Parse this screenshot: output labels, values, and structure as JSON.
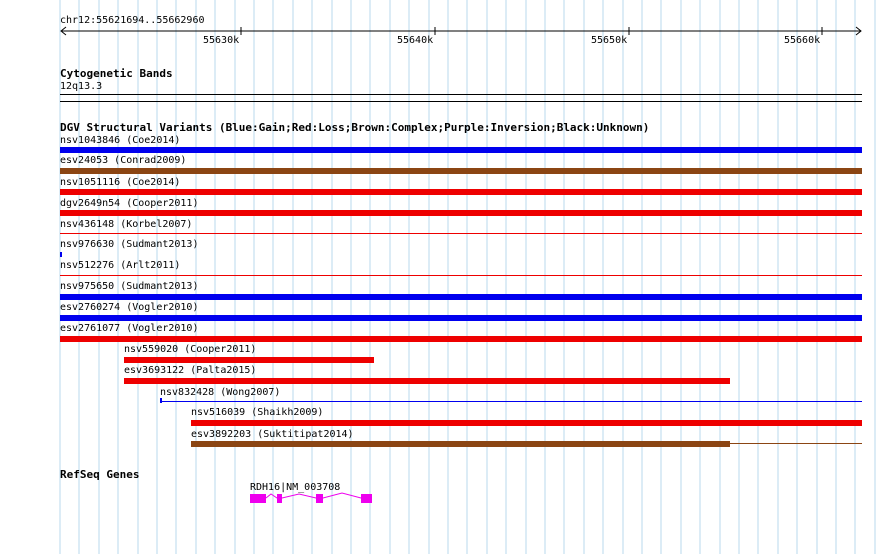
{
  "ruler": {
    "region": "chr12:55621694..55662960",
    "ticks": [
      "55630k",
      "55640k",
      "55650k",
      "55660k"
    ]
  },
  "cytoband": {
    "title": "Cytogenetic Bands",
    "band": "12q13.3"
  },
  "dgv": {
    "title": "DGV Structural Variants (Blue:Gain;Red:Loss;Brown:Complex;Purple:Inversion;Black:Unknown)",
    "colors": {
      "gain": "#0000ee",
      "loss": "#ee0000",
      "complex": "#8b4513"
    },
    "variants": [
      {
        "label": "nsv1043846 (Coe2014)",
        "type": "gain"
      },
      {
        "label": "esv24053 (Conrad2009)",
        "type": "complex"
      },
      {
        "label": "nsv1051116 (Coe2014)",
        "type": "loss"
      },
      {
        "label": "dgv2649n54 (Cooper2011)",
        "type": "loss"
      },
      {
        "label": "nsv436148 (Korbel2007)",
        "type": "loss"
      },
      {
        "label": "nsv976630 (Sudmant2013)",
        "type": "gain"
      },
      {
        "label": "nsv512276 (Arlt2011)",
        "type": "loss"
      },
      {
        "label": "nsv975650 (Sudmant2013)",
        "type": "gain"
      },
      {
        "label": "esv2760274 (Vogler2010)",
        "type": "gain"
      },
      {
        "label": "esv2761077 (Vogler2010)",
        "type": "loss"
      },
      {
        "label": "nsv559020 (Cooper2011)",
        "type": "loss"
      },
      {
        "label": "esv3693122 (Palta2015)",
        "type": "loss"
      },
      {
        "label": "nsv832428 (Wong2007)",
        "type": "gain"
      },
      {
        "label": "nsv516039 (Shaikh2009)",
        "type": "loss"
      },
      {
        "label": "esv3892203 (Suktitipat2014)",
        "type": "complex"
      }
    ]
  },
  "refseq": {
    "title": "RefSeq Genes",
    "gene_label": "RDH16|NM_003708",
    "color": "#ee00ee"
  }
}
